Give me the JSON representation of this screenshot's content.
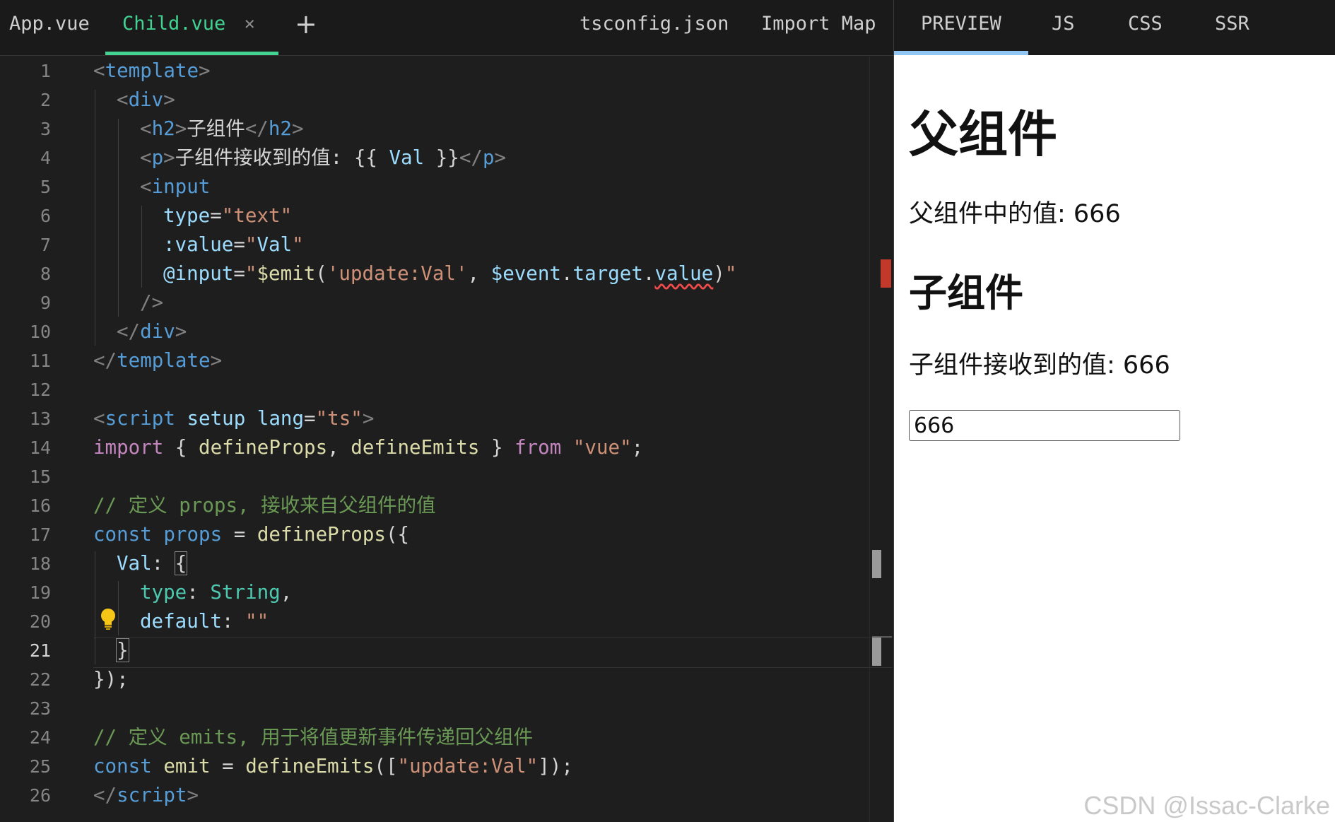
{
  "editor": {
    "tabs": [
      {
        "label": "App.vue",
        "active": false
      },
      {
        "label": "Child.vue",
        "active": true,
        "closable": true
      },
      {
        "label": "+"
      },
      {
        "label": "tsconfig.json"
      },
      {
        "label": "Import Map"
      }
    ],
    "line_numbers": [
      "1",
      "2",
      "3",
      "4",
      "5",
      "6",
      "7",
      "8",
      "9",
      "10",
      "11",
      "12",
      "13",
      "14",
      "15",
      "16",
      "17",
      "18",
      "19",
      "20",
      "21",
      "22",
      "23",
      "24",
      "25",
      "26"
    ],
    "current_line": 21,
    "code": {
      "l1": {
        "a": "<",
        "b": "template",
        "c": ">"
      },
      "l2": {
        "a": "<",
        "b": "div",
        "c": ">"
      },
      "l3": {
        "a": "<",
        "b": "h2",
        "c": ">",
        "d": "子组件",
        "e": "</",
        "f": "h2",
        "g": ">"
      },
      "l4": {
        "a": "<",
        "b": "p",
        "c": ">",
        "d": "子组件接收到的值: ",
        "e": "{{ ",
        "f": "Val",
        "g": " }}",
        "h": "</",
        "i": "p",
        "j": ">"
      },
      "l5": {
        "a": "<",
        "b": "input"
      },
      "l6": {
        "a": "type",
        "b": "=",
        "c": "\"text\""
      },
      "l7": {
        "a": ":value",
        "b": "=",
        "c": "\"",
        "d": "Val",
        "e": "\""
      },
      "l8": {
        "a": "@input",
        "b": "=",
        "c": "\"",
        "d": "$emit",
        "e": "(",
        "f": "'update:Val'",
        "g": ", ",
        "h": "$event",
        "i": ".",
        "j": "target",
        "k": ".",
        "l": "value",
        "m": ")",
        "n": "\""
      },
      "l9": {
        "a": "/>"
      },
      "l10": {
        "a": "</",
        "b": "div",
        "c": ">"
      },
      "l11": {
        "a": "</",
        "b": "template",
        "c": ">"
      },
      "l13": {
        "a": "<",
        "b": "script",
        "c": " setup",
        "d": " lang",
        "e": "=",
        "f": "\"ts\"",
        "g": ">"
      },
      "l14": {
        "a": "import",
        "b": " { ",
        "c": "defineProps",
        "d": ", ",
        "e": "defineEmits",
        "f": " } ",
        "g": "from",
        "h": " ",
        "i": "\"vue\"",
        "j": ";"
      },
      "l16": {
        "a": "// 定义 props, 接收来自父组件的值"
      },
      "l17": {
        "a": "const",
        "b": " ",
        "c": "props",
        "d": " = ",
        "e": "defineProps",
        "f": "({"
      },
      "l18": {
        "a": "Val",
        "b": ": ",
        "c": "{"
      },
      "l19": {
        "a": "type",
        "b": ": ",
        "c": "String",
        "d": ","
      },
      "l20": {
        "a": "default",
        "b": ": ",
        "c": "\"\""
      },
      "l21": {
        "a": "}"
      },
      "l22": {
        "a": "});"
      },
      "l24": {
        "a": "// 定义 emits, 用于将值更新事件传递回父组件"
      },
      "l25": {
        "a": "const",
        "b": " ",
        "c": "emit",
        "d": " = ",
        "e": "defineEmits",
        "f": "([",
        "g": "\"update:Val\"",
        "h": "]);"
      },
      "l26": {
        "a": "</",
        "b": "script",
        "c": ">"
      }
    }
  },
  "preview": {
    "tabs": [
      {
        "label": "PREVIEW",
        "active": true
      },
      {
        "label": "JS"
      },
      {
        "label": "CSS"
      },
      {
        "label": "SSR"
      }
    ],
    "parent_heading": "父组件",
    "parent_value_text": "父组件中的值: 666",
    "child_heading": "子组件",
    "child_value_text": "子组件接收到的值: 666",
    "child_input_value": "666"
  },
  "watermark": "CSDN @Issac-Clarke",
  "colors": {
    "accent": "#42d392",
    "preview_tab_underline": "#8fc6f3"
  },
  "icons": [
    "close-icon",
    "plus-icon",
    "lightbulb-icon"
  ]
}
